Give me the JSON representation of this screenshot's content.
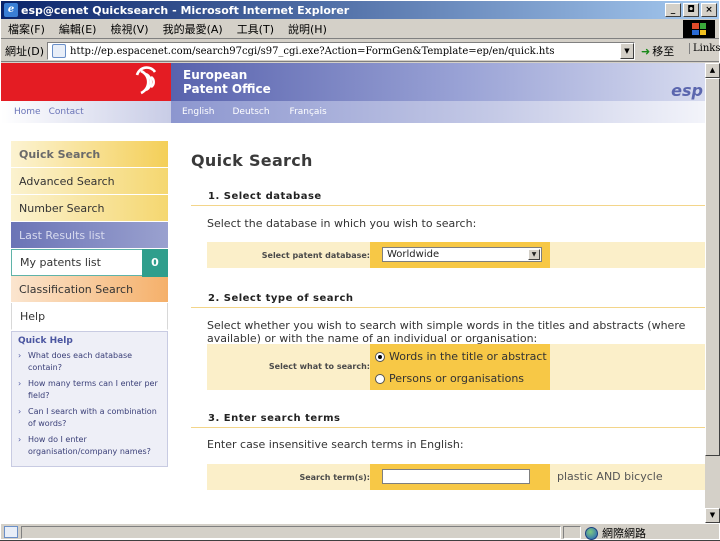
{
  "window": {
    "title": "esp@cenet Quicksearch - Microsoft Internet Explorer",
    "buttons": [
      "_",
      "◘",
      "×"
    ]
  },
  "menubar": [
    "檔案(F)",
    "編輯(E)",
    "檢視(V)",
    "我的最愛(A)",
    "工具(T)",
    "說明(H)"
  ],
  "addressbar": {
    "label": "網址(D)",
    "url": "http://ep.espacenet.com/search97cgi/s97_cgi.exe?Action=FormGen&Template=ep/en/quick.hts",
    "go_label": "移至",
    "links_label": "Links"
  },
  "header": {
    "org_line1": "European",
    "org_line2": "Patent Office",
    "brand_tail": "esp",
    "nav_left": [
      "Home",
      "Contact"
    ],
    "languages": [
      "English",
      "Deutsch",
      "Français"
    ]
  },
  "sidebar": {
    "items": [
      {
        "label": "Quick Search",
        "state": "active"
      },
      {
        "label": "Advanced Search"
      },
      {
        "label": "Number Search"
      },
      {
        "label": "Last Results list"
      },
      {
        "label": "My patents list",
        "count": "0"
      },
      {
        "label": "Classification Search"
      },
      {
        "label": "Help"
      }
    ]
  },
  "quick_help": {
    "title": "Quick Help",
    "items": [
      "What does each database contain?",
      "How many terms can I enter per field?",
      "Can I search with a combination of words?",
      "How do I enter organisation/company names?"
    ]
  },
  "main": {
    "title": "Quick Search",
    "s1": {
      "heading": "1. Select database",
      "text": "Select the database in which you wish to search:",
      "field_label": "Select patent database:",
      "selected": "Worldwide"
    },
    "s2": {
      "heading": "2. Select type of search",
      "text": "Select whether you wish to search with simple words in the titles and abstracts (where available) or with the name of an individual or organisation:",
      "field_label": "Select what to search:",
      "options": [
        "Words in the title or abstract",
        "Persons or organisations"
      ],
      "selected_index": 0
    },
    "s3": {
      "heading": "3. Enter search terms",
      "text": "Enter case insensitive search terms in English:",
      "field_label": "Search term(s):",
      "value": "",
      "example": "plastic AND bicycle"
    }
  },
  "statusbar": {
    "zone": "網際網路"
  },
  "colors": {
    "epo_red": "#e41c23",
    "epo_blue": "#5862ad",
    "sidebar_yellow": "#f5d770",
    "teal": "#2f9e8c"
  }
}
